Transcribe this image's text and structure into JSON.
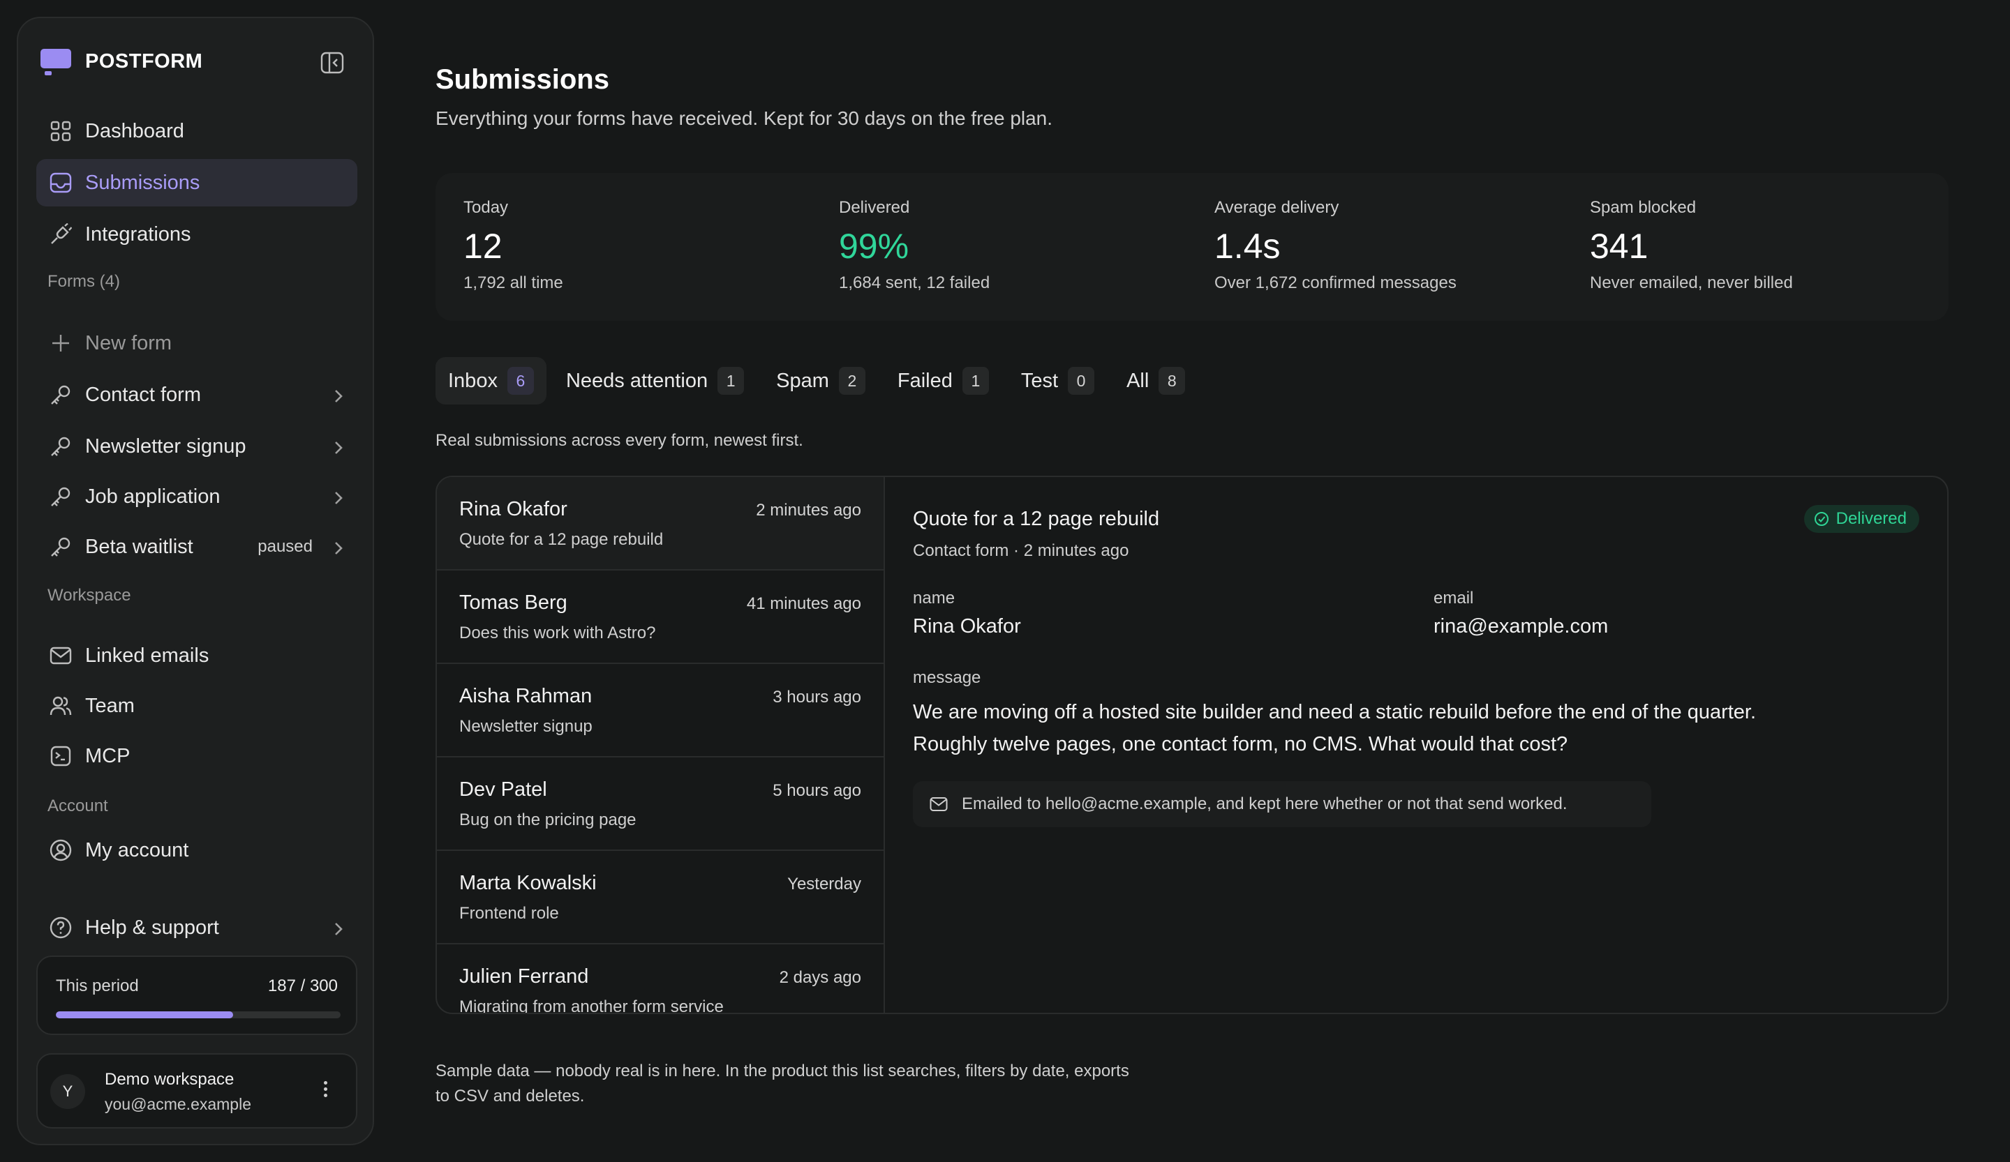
{
  "brand": {
    "name": "POSTFORM"
  },
  "sidebar": {
    "main_nav": [
      {
        "label": "Dashboard",
        "icon": "grid-icon"
      },
      {
        "label": "Submissions",
        "icon": "inbox-icon",
        "active": true
      },
      {
        "label": "Integrations",
        "icon": "plug-icon"
      }
    ],
    "forms_label": "Forms (4)",
    "new_form_label": "New form",
    "forms": [
      {
        "label": "Contact form",
        "icon": "key-icon"
      },
      {
        "label": "Newsletter signup",
        "icon": "key-icon"
      },
      {
        "label": "Job application",
        "icon": "key-icon"
      },
      {
        "label": "Beta waitlist",
        "icon": "key-icon",
        "status": "paused"
      }
    ],
    "workspace_label": "Workspace",
    "workspace_nav": [
      {
        "label": "Linked emails",
        "icon": "mail-icon"
      },
      {
        "label": "Team",
        "icon": "users-icon"
      },
      {
        "label": "MCP",
        "icon": "terminal-icon"
      }
    ],
    "account_label": "Account",
    "account_nav": [
      {
        "label": "My account",
        "icon": "user-circle-icon"
      }
    ],
    "help_label": "Help & support",
    "period": {
      "label": "This period",
      "value": "187 / 300",
      "used_fraction": 0.623
    },
    "workspace": {
      "avatar_initial": "Y",
      "name": "Demo workspace",
      "email": "you@acme.example"
    }
  },
  "header": {
    "title": "Submissions",
    "subtitle": "Everything your forms have received. Kept for 30 days on the free plan."
  },
  "stats": [
    {
      "label": "Today",
      "value": "12",
      "note": "1,792 all time"
    },
    {
      "label": "Delivered",
      "value": "99%",
      "note": "1,684 sent, 12 failed",
      "accent": "#30d69a"
    },
    {
      "label": "Average delivery",
      "value": "1.4s",
      "note": "Over 1,672 confirmed messages"
    },
    {
      "label": "Spam blocked",
      "value": "341",
      "note": "Never emailed, never billed"
    }
  ],
  "tabs": [
    {
      "label": "Inbox",
      "count": "6",
      "active": true
    },
    {
      "label": "Needs attention",
      "count": "1"
    },
    {
      "label": "Spam",
      "count": "2"
    },
    {
      "label": "Failed",
      "count": "1"
    },
    {
      "label": "Test",
      "count": "0"
    },
    {
      "label": "All",
      "count": "8"
    }
  ],
  "list_caption": "Real submissions across every form, newest first.",
  "submissions": [
    {
      "name": "Rina Okafor",
      "time": "2 minutes ago",
      "subject": "Quote for a 12 page rebuild"
    },
    {
      "name": "Tomas Berg",
      "time": "41 minutes ago",
      "subject": "Does this work with Astro?"
    },
    {
      "name": "Aisha Rahman",
      "time": "3 hours ago",
      "subject": "Newsletter signup"
    },
    {
      "name": "Dev Patel",
      "time": "5 hours ago",
      "subject": "Bug on the pricing page"
    },
    {
      "name": "Marta Kowalski",
      "time": "Yesterday",
      "subject": "Frontend role"
    },
    {
      "name": "Julien Ferrand",
      "time": "2 days ago",
      "subject": "Migrating from another form service"
    }
  ],
  "detail": {
    "subject": "Quote for a 12 page rebuild",
    "meta": "Contact form · 2 minutes ago",
    "status": "Delivered",
    "fields": {
      "name_label": "name",
      "name_value": "Rina Okafor",
      "email_label": "email",
      "email_value": "rina@example.com",
      "message_label": "message",
      "message_line1": "We are moving off a hosted site builder and need a static rebuild before the end of the quarter.",
      "message_line2": "Roughly twelve pages, one contact form, no CMS. What would that cost?"
    },
    "delivery_note": "Emailed to hello@acme.example, and kept here whether or not that send worked."
  },
  "footer_note": {
    "line1": "Sample data — nobody real is in here. In the product this list searches, filters by date, exports",
    "line2": "to CSV and deletes."
  },
  "colors": {
    "accent": "#9b8cf2",
    "success": "#30d69a",
    "background": "#161818"
  }
}
